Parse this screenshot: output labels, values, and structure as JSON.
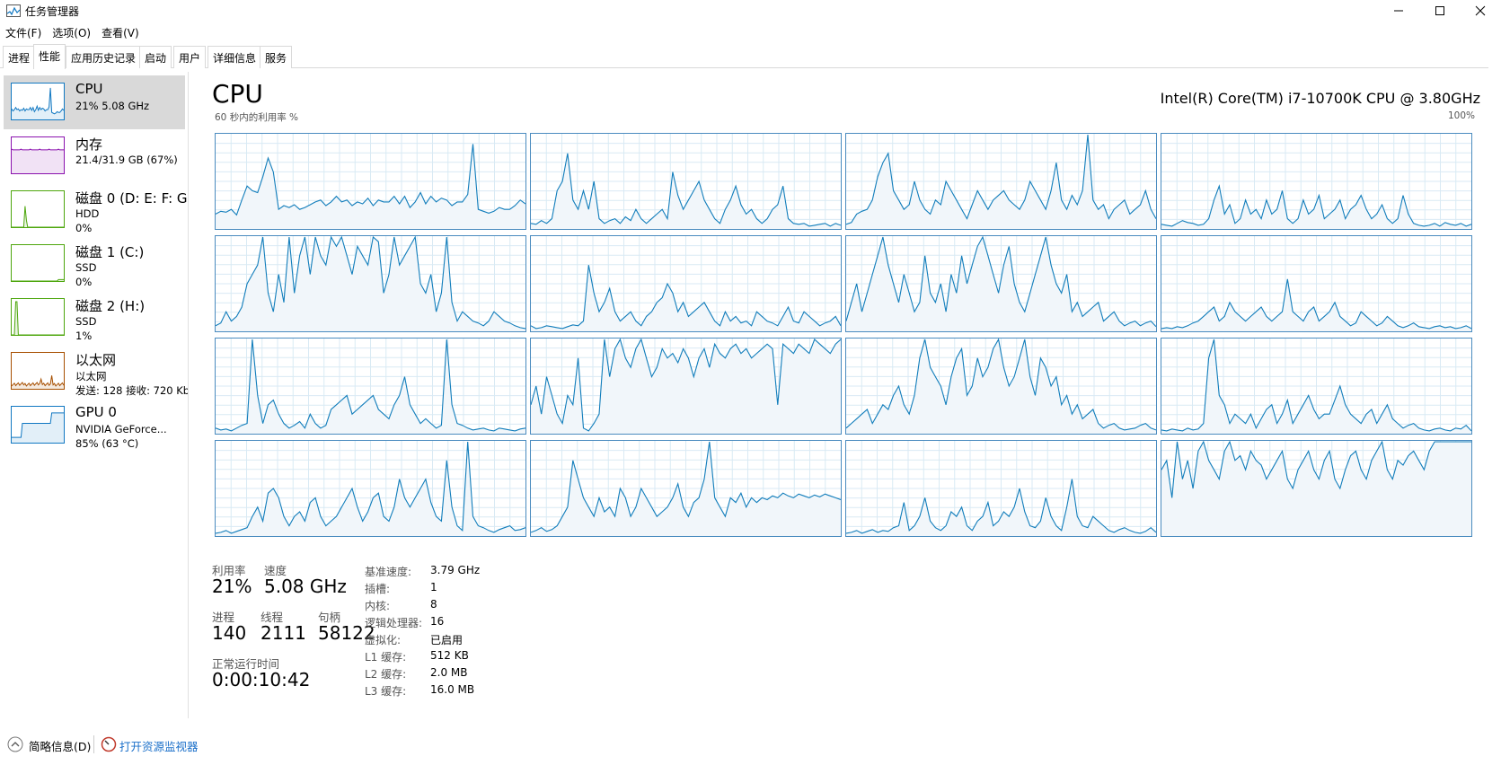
{
  "window": {
    "title": "任务管理器"
  },
  "menu": [
    "文件(F)",
    "选项(O)",
    "查看(V)"
  ],
  "tabs": [
    "进程",
    "性能",
    "应用历史记录",
    "启动",
    "用户",
    "详细信息",
    "服务"
  ],
  "sidebar": [
    {
      "title": "CPU",
      "line1": "21% 5.08 GHz",
      "line2": "",
      "color": "#1178c2",
      "selected": true
    },
    {
      "title": "内存",
      "line1": "21.4/31.9 GB (67%)",
      "line2": "",
      "color": "#8b12ae",
      "selected": false
    },
    {
      "title": "磁盘 0 (D: E: F: G:",
      "line1": "HDD",
      "line2": "0%",
      "color": "#4da60c",
      "selected": false
    },
    {
      "title": "磁盘 1 (C:)",
      "line1": "SSD",
      "line2": "0%",
      "color": "#4da60c",
      "selected": false
    },
    {
      "title": "磁盘 2 (H:)",
      "line1": "SSD",
      "line2": "1%",
      "color": "#4da60c",
      "selected": false
    },
    {
      "title": "以太网",
      "line1": "以太网",
      "line2": "发送: 128 接收: 720 Kb",
      "color": "#a74f01",
      "selected": false
    },
    {
      "title": "GPU 0",
      "line1": "NVIDIA GeForce...",
      "line2": "85% (63 °C)",
      "color": "#1178c2",
      "selected": false
    }
  ],
  "main": {
    "title": "CPU",
    "cpu_name": "Intel(R) Core(TM) i7-10700K CPU @ 3.80GHz",
    "graph_label": "60 秒内的利用率 %",
    "graph_max": "100%",
    "stats": {
      "util_label": "利用率",
      "util_value": "21%",
      "speed_label": "速度",
      "speed_value": "5.08 GHz",
      "proc_label": "进程",
      "proc_value": "140",
      "thread_label": "线程",
      "thread_value": "2111",
      "handle_label": "句柄",
      "handle_value": "58122",
      "uptime_label": "正常运行时间",
      "uptime_value": "0:00:10:42"
    },
    "specs": [
      {
        "label": "基准速度:",
        "value": "3.79 GHz"
      },
      {
        "label": "插槽:",
        "value": "1"
      },
      {
        "label": "内核:",
        "value": "8"
      },
      {
        "label": "逻辑处理器:",
        "value": "16"
      },
      {
        "label": "虚拟化:",
        "value": "已启用"
      },
      {
        "label": "L1 缓存:",
        "value": "512 KB"
      },
      {
        "label": "L2 缓存:",
        "value": "2.0 MB"
      },
      {
        "label": "L3 缓存:",
        "value": "16.0 MB"
      }
    ]
  },
  "bottom": {
    "brief_label": "简略信息(D)",
    "monitor_label": "打开资源监视器"
  },
  "colors": {
    "accent": "#1178c2",
    "graph_line": "#117dbb",
    "graph_fill": "#f1f6fa",
    "grid": "#d9eaf4"
  },
  "chart_data": {
    "type": "area",
    "title": "CPU",
    "ylabel": "60 秒内的利用率 %",
    "ylim": [
      0,
      100
    ],
    "cores": [
      [
        15,
        18,
        17,
        20,
        14,
        30,
        45,
        40,
        38,
        55,
        75,
        60,
        20,
        24,
        22,
        25,
        20,
        22,
        25,
        28,
        30,
        24,
        28,
        34,
        28,
        30,
        24,
        28,
        26,
        32,
        24,
        30,
        28,
        28,
        34,
        26,
        34,
        22,
        28,
        38,
        26,
        34,
        28,
        32,
        30,
        24,
        28,
        28,
        36,
        90,
        20,
        18,
        16,
        18,
        22,
        20,
        20,
        24,
        30,
        26
      ],
      [
        5,
        4,
        8,
        5,
        10,
        40,
        50,
        80,
        30,
        20,
        40,
        20,
        50,
        10,
        5,
        8,
        10,
        5,
        12,
        8,
        20,
        10,
        5,
        10,
        15,
        20,
        10,
        60,
        35,
        20,
        30,
        40,
        50,
        30,
        20,
        10,
        5,
        20,
        30,
        45,
        25,
        15,
        20,
        10,
        5,
        10,
        20,
        25,
        45,
        10,
        5,
        4,
        5,
        2,
        3,
        4,
        5,
        2,
        5,
        3
      ],
      [
        4,
        6,
        15,
        18,
        20,
        30,
        55,
        70,
        80,
        40,
        30,
        20,
        25,
        50,
        30,
        20,
        15,
        30,
        25,
        50,
        40,
        30,
        20,
        10,
        25,
        40,
        30,
        20,
        30,
        35,
        40,
        30,
        25,
        20,
        30,
        50,
        40,
        30,
        20,
        40,
        70,
        30,
        20,
        35,
        25,
        40,
        100,
        30,
        20,
        25,
        10,
        20,
        25,
        30,
        15,
        20,
        25,
        40,
        20,
        10
      ],
      [
        4,
        3,
        2,
        5,
        8,
        6,
        5,
        3,
        4,
        10,
        30,
        45,
        15,
        25,
        5,
        10,
        30,
        15,
        20,
        10,
        30,
        15,
        20,
        40,
        10,
        5,
        10,
        30,
        15,
        20,
        35,
        10,
        15,
        20,
        30,
        10,
        20,
        25,
        35,
        20,
        10,
        15,
        25,
        10,
        5,
        10,
        35,
        15,
        5,
        3,
        2,
        3,
        5,
        2,
        6,
        4,
        3,
        5,
        2,
        4
      ],
      [
        5,
        8,
        20,
        10,
        15,
        25,
        50,
        60,
        70,
        100,
        40,
        20,
        60,
        30,
        100,
        40,
        80,
        100,
        60,
        100,
        80,
        70,
        100,
        90,
        100,
        80,
        60,
        90,
        80,
        70,
        100,
        95,
        40,
        60,
        100,
        70,
        80,
        90,
        100,
        50,
        40,
        60,
        20,
        40,
        100,
        30,
        10,
        20,
        15,
        10,
        8,
        5,
        10,
        20,
        15,
        10,
        8,
        5,
        3,
        2
      ],
      [
        5,
        2,
        3,
        5,
        4,
        3,
        2,
        4,
        6,
        5,
        10,
        70,
        40,
        20,
        30,
        45,
        20,
        10,
        15,
        20,
        10,
        5,
        15,
        20,
        30,
        35,
        50,
        40,
        20,
        30,
        15,
        20,
        25,
        30,
        20,
        10,
        5,
        20,
        10,
        15,
        8,
        10,
        5,
        20,
        15,
        10,
        8,
        5,
        15,
        25,
        10,
        8,
        20,
        15,
        10,
        5,
        8,
        10,
        15,
        5
      ],
      [
        10,
        30,
        50,
        20,
        40,
        60,
        80,
        100,
        70,
        50,
        30,
        60,
        40,
        20,
        30,
        80,
        40,
        30,
        50,
        20,
        60,
        40,
        80,
        50,
        70,
        90,
        100,
        80,
        60,
        40,
        70,
        90,
        50,
        30,
        20,
        40,
        60,
        80,
        100,
        70,
        50,
        40,
        60,
        20,
        30,
        15,
        20,
        25,
        30,
        10,
        15,
        20,
        10,
        5,
        8,
        10,
        5,
        8,
        10,
        4
      ],
      [
        2,
        3,
        2,
        4,
        3,
        5,
        8,
        10,
        15,
        20,
        25,
        10,
        15,
        30,
        20,
        15,
        10,
        15,
        20,
        25,
        15,
        10,
        15,
        20,
        55,
        20,
        15,
        10,
        20,
        25,
        10,
        15,
        20,
        30,
        15,
        10,
        5,
        8,
        20,
        15,
        10,
        5,
        8,
        15,
        10,
        5,
        3,
        5,
        8,
        4,
        3,
        2,
        4,
        5,
        3,
        4,
        2,
        3,
        5,
        2
      ],
      [
        5,
        3,
        4,
        2,
        5,
        8,
        10,
        100,
        40,
        10,
        30,
        35,
        20,
        10,
        5,
        8,
        12,
        5,
        20,
        10,
        5,
        8,
        25,
        30,
        35,
        40,
        20,
        25,
        30,
        35,
        40,
        25,
        20,
        15,
        30,
        40,
        60,
        30,
        20,
        10,
        15,
        10,
        5,
        8,
        100,
        30,
        10,
        8,
        5,
        3,
        4,
        5,
        3,
        2,
        5,
        4,
        3,
        2,
        4,
        5
      ],
      [
        30,
        50,
        20,
        60,
        40,
        20,
        10,
        40,
        30,
        80,
        5,
        2,
        10,
        20,
        100,
        60,
        90,
        100,
        80,
        70,
        90,
        100,
        80,
        60,
        70,
        90,
        80,
        85,
        75,
        90,
        80,
        60,
        80,
        90,
        70,
        95,
        85,
        80,
        90,
        95,
        85,
        90,
        80,
        85,
        90,
        95,
        90,
        30,
        95,
        90,
        85,
        95,
        90,
        85,
        100,
        95,
        90,
        85,
        95,
        100
      ],
      [
        5,
        10,
        15,
        20,
        25,
        10,
        20,
        30,
        25,
        40,
        50,
        30,
        20,
        40,
        80,
        100,
        70,
        60,
        50,
        30,
        60,
        80,
        90,
        40,
        50,
        80,
        60,
        70,
        90,
        100,
        70,
        50,
        60,
        80,
        100,
        60,
        40,
        80,
        70,
        50,
        60,
        30,
        40,
        20,
        30,
        15,
        20,
        25,
        10,
        5,
        8,
        10,
        5,
        3,
        4,
        5,
        8,
        10,
        5,
        3
      ],
      [
        3,
        2,
        4,
        3,
        2,
        5,
        3,
        4,
        10,
        80,
        100,
        40,
        30,
        10,
        20,
        15,
        10,
        20,
        5,
        15,
        25,
        30,
        10,
        20,
        35,
        10,
        20,
        30,
        40,
        25,
        15,
        20,
        20,
        35,
        50,
        30,
        20,
        15,
        10,
        20,
        25,
        10,
        20,
        30,
        15,
        10,
        5,
        8,
        10,
        5,
        3,
        2,
        4,
        5,
        3,
        2,
        5,
        4,
        8,
        2
      ],
      [
        2,
        3,
        5,
        2,
        4,
        6,
        8,
        20,
        30,
        15,
        45,
        50,
        40,
        20,
        10,
        20,
        25,
        15,
        35,
        40,
        20,
        10,
        15,
        20,
        30,
        40,
        50,
        30,
        15,
        25,
        40,
        45,
        20,
        15,
        30,
        60,
        40,
        30,
        40,
        50,
        60,
        35,
        20,
        15,
        80,
        30,
        10,
        5,
        100,
        20,
        10,
        8,
        5,
        3,
        6,
        8,
        10,
        5,
        6,
        8
      ],
      [
        3,
        5,
        8,
        4,
        6,
        10,
        20,
        30,
        80,
        60,
        40,
        30,
        20,
        40,
        25,
        30,
        20,
        50,
        40,
        20,
        30,
        50,
        40,
        30,
        20,
        25,
        30,
        40,
        55,
        30,
        20,
        35,
        40,
        60,
        100,
        40,
        30,
        20,
        40,
        35,
        45,
        30,
        40,
        35,
        40,
        38,
        42,
        40,
        45,
        42,
        40,
        44,
        42,
        40,
        43,
        41,
        44,
        42,
        40,
        38
      ],
      [
        2,
        3,
        5,
        2,
        4,
        6,
        3,
        5,
        4,
        8,
        10,
        35,
        5,
        10,
        20,
        40,
        15,
        8,
        5,
        10,
        25,
        20,
        30,
        10,
        5,
        15,
        20,
        35,
        10,
        15,
        25,
        20,
        30,
        50,
        25,
        10,
        8,
        15,
        40,
        20,
        10,
        5,
        30,
        60,
        20,
        10,
        8,
        20,
        15,
        10,
        5,
        3,
        6,
        8,
        5,
        3,
        2,
        4,
        8,
        3
      ],
      [
        70,
        80,
        40,
        100,
        60,
        80,
        50,
        90,
        100,
        80,
        70,
        60,
        90,
        100,
        80,
        85,
        70,
        90,
        80,
        75,
        60,
        70,
        80,
        90,
        60,
        50,
        70,
        80,
        90,
        70,
        60,
        80,
        90,
        60,
        50,
        70,
        85,
        90,
        70,
        60,
        80,
        90,
        100,
        70,
        60,
        80,
        75,
        85,
        90,
        80,
        70,
        90,
        100,
        100,
        100,
        100,
        100,
        100,
        100,
        100
      ]
    ]
  }
}
